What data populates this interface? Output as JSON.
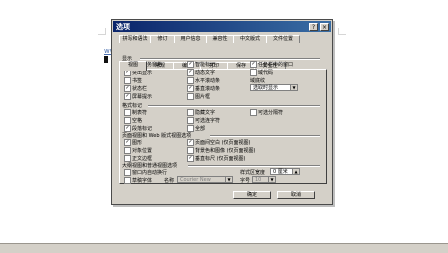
{
  "background_doc": {
    "link_text": "www.7",
    "colors": {
      "link": "#4a6fb0",
      "titlebar_start": "#0a246a",
      "titlebar_end": "#3a6ea5"
    }
  },
  "dialog": {
    "title": "选项",
    "help_btn": "?",
    "close_btn": "×",
    "tabs_row1": [
      "拼写和语法",
      "修订",
      "用户信息",
      "兼容性",
      "中文版式",
      "文件位置"
    ],
    "tabs_row2": [
      "视图",
      "常规",
      "编辑",
      "打印",
      "保存",
      "安全性"
    ],
    "active_tab": "视图",
    "section_show": "显示",
    "show_items": {
      "col1": [
        {
          "label": "启动任务窗格",
          "checked": true
        },
        {
          "label": "突出显示",
          "checked": true
        },
        {
          "label": "书签",
          "checked": false
        },
        {
          "label": "状态栏",
          "checked": true
        },
        {
          "label": "屏幕提示",
          "checked": true
        }
      ],
      "col2": [
        {
          "label": "智能标记",
          "checked": true
        },
        {
          "label": "动态文字",
          "checked": true
        },
        {
          "label": "水平滚动条",
          "checked": false
        },
        {
          "label": "垂直滚动条",
          "checked": true
        },
        {
          "label": "图片框",
          "checked": false
        }
      ],
      "col3": [
        {
          "label": "任务栏中的窗口",
          "checked": true
        },
        {
          "label": "域代码",
          "checked": false
        },
        {
          "label": "域底纹",
          "checked": false
        }
      ],
      "field_shading_value": "选取时显示"
    },
    "section_format": "格式标记",
    "format_items": {
      "col1": [
        {
          "label": "制表符",
          "checked": false
        },
        {
          "label": "空格",
          "checked": false
        },
        {
          "label": "段落标记",
          "checked": true
        }
      ],
      "col2": [
        {
          "label": "隐藏文字",
          "checked": false
        },
        {
          "label": "可选连字符",
          "checked": false
        },
        {
          "label": "全部",
          "checked": false
        }
      ],
      "col3": [
        {
          "label": "可选分隔符",
          "checked": false
        }
      ]
    },
    "section_print": "页面视图和 Web 版式视图选项",
    "print_items": {
      "col1": [
        {
          "label": "图形",
          "checked": true
        },
        {
          "label": "对象位置",
          "checked": false
        },
        {
          "label": "正文边框",
          "checked": false
        }
      ],
      "col2": [
        {
          "label": "页面间空白 (仅页面视图)",
          "checked": true
        },
        {
          "label": "背景色和图像 (仅页面视图)",
          "checked": false
        },
        {
          "label": "垂直标尺 (仅页面视图)",
          "checked": true
        }
      ]
    },
    "section_outline": "大纲视图和普通视图选项",
    "outline_items": [
      {
        "label": "窗口内自动换行",
        "checked": false
      },
      {
        "label": "草稿字体",
        "checked": false
      }
    ],
    "style_width_label": "样式区宽度",
    "style_width_value": "0 厘米",
    "font_name_label": "名称",
    "font_name_value": "Courier New",
    "font_size_label": "字号",
    "font_size_value": "10",
    "ok": "确定",
    "cancel": "取消"
  }
}
